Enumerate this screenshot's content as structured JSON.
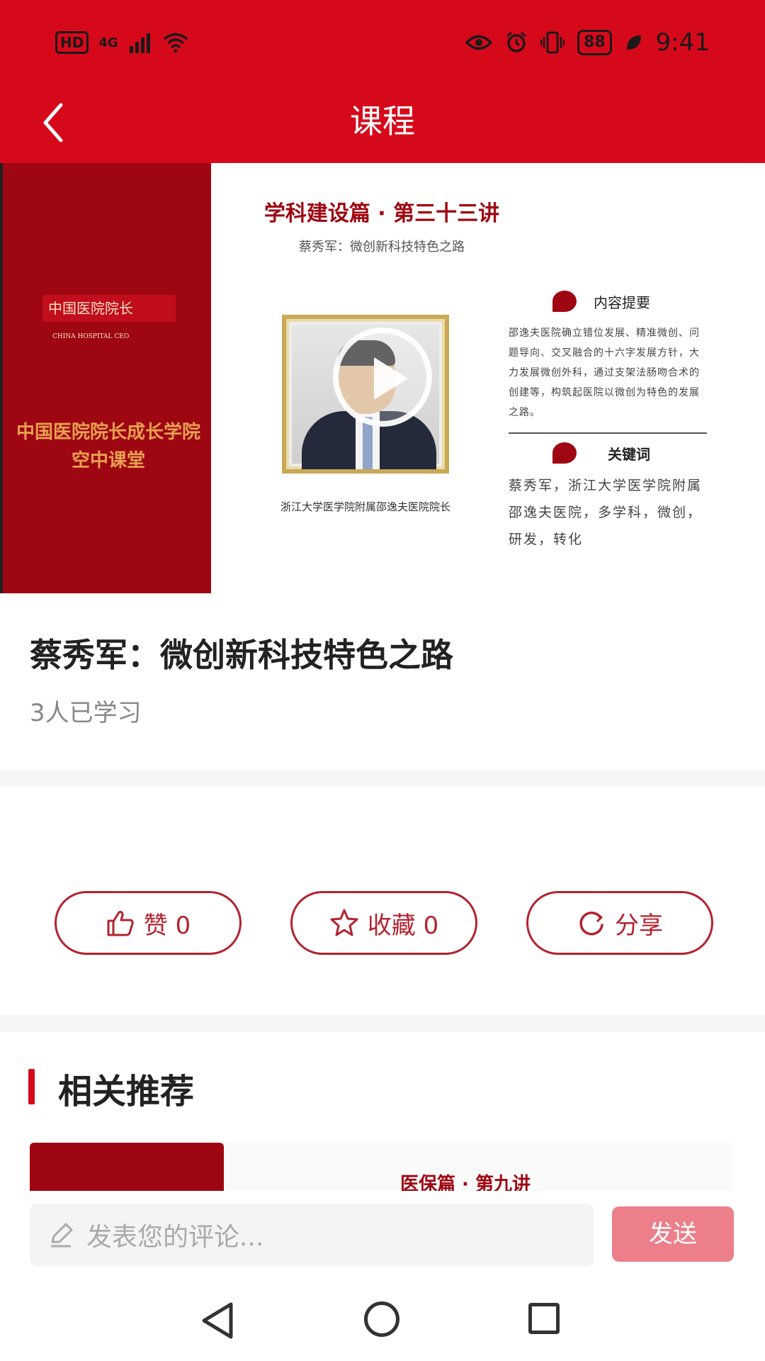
{
  "status_bar": {
    "hd": "HD",
    "network": "4G",
    "battery": "88",
    "time": "9:41"
  },
  "header": {
    "title": "课程"
  },
  "banner": {
    "logo_text": "中国医院院长",
    "logo_small": "CHINA HOSPITAL CEO",
    "left_text_line1": "中国医院院长成长学院",
    "left_text_line2": "空中课堂",
    "title": "学科建设篇 · 第三十三讲",
    "subtitle": "蔡秀军：微创新科技特色之路",
    "caption": "浙江大学医学院附属邵逸夫医院院长",
    "summary_heading": "内容提要",
    "summary_text": "邵逸夫医院确立错位发展、精准微创、问题导向、交叉融合的十六字发展方针，大力发展微创外科，通过支架法肠吻合术的创建等，构筑起医院以微创为特色的发展之路。",
    "keywords_heading": "关键词",
    "keywords_text": "蔡秀军，浙江大学医学院附属邵逸夫医院，多学科，微创，研发，转化"
  },
  "course": {
    "title": "蔡秀军：微创新科技特色之路",
    "learners": "3人已学习"
  },
  "actions": {
    "like_label": "赞 0",
    "favorite_label": "收藏 0",
    "share_label": "分享"
  },
  "recommend": {
    "heading": "相关推荐",
    "first_item_title": "医保篇 · 第九讲"
  },
  "comment": {
    "placeholder": "发表您的评论...",
    "send_label": "发送"
  },
  "colors": {
    "brand_red": "#d6091b",
    "dark_red": "#9e0712",
    "send_disabled": "#ec7f89"
  }
}
